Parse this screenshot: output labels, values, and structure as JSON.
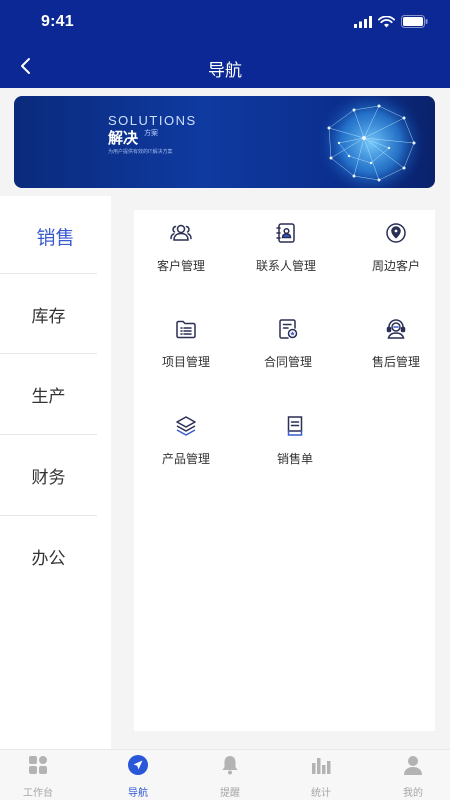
{
  "status_bar": {
    "time": "9:41"
  },
  "nav": {
    "title": "导航"
  },
  "banner": {
    "title": "SOLUTIONS",
    "main": "解决",
    "sub": "方案",
    "tagline": "为用户提供有效的IT解决方案"
  },
  "sidebar": {
    "items": [
      {
        "label": "销售",
        "active": true
      },
      {
        "label": "库存",
        "active": false
      },
      {
        "label": "生产",
        "active": false
      },
      {
        "label": "财务",
        "active": false
      },
      {
        "label": "办公",
        "active": false
      }
    ]
  },
  "grid": {
    "items": [
      {
        "label": "客户管理",
        "icon": "customers-icon"
      },
      {
        "label": "联系人管理",
        "icon": "contacts-book-icon"
      },
      {
        "label": "周边客户",
        "icon": "location-icon"
      },
      {
        "label": "项目管理",
        "icon": "project-list-icon"
      },
      {
        "label": "合同管理",
        "icon": "contract-icon"
      },
      {
        "label": "售后管理",
        "icon": "headset-icon"
      },
      {
        "label": "产品管理",
        "icon": "layers-icon"
      },
      {
        "label": "销售单",
        "icon": "sales-order-icon"
      }
    ]
  },
  "tabbar": {
    "items": [
      {
        "label": "工作台",
        "icon": "grid-icon",
        "active": false
      },
      {
        "label": "导航",
        "icon": "navigation-icon",
        "active": true
      },
      {
        "label": "提醒",
        "icon": "bell-icon",
        "active": false
      },
      {
        "label": "统计",
        "icon": "bar-chart-icon",
        "active": false
      },
      {
        "label": "我的",
        "icon": "user-icon",
        "active": false
      }
    ],
    "active_color": "#2a56d8",
    "inactive_color": "#a6a6a6"
  },
  "colors": {
    "header": "#0b2894",
    "accent": "#3a5bd0"
  }
}
